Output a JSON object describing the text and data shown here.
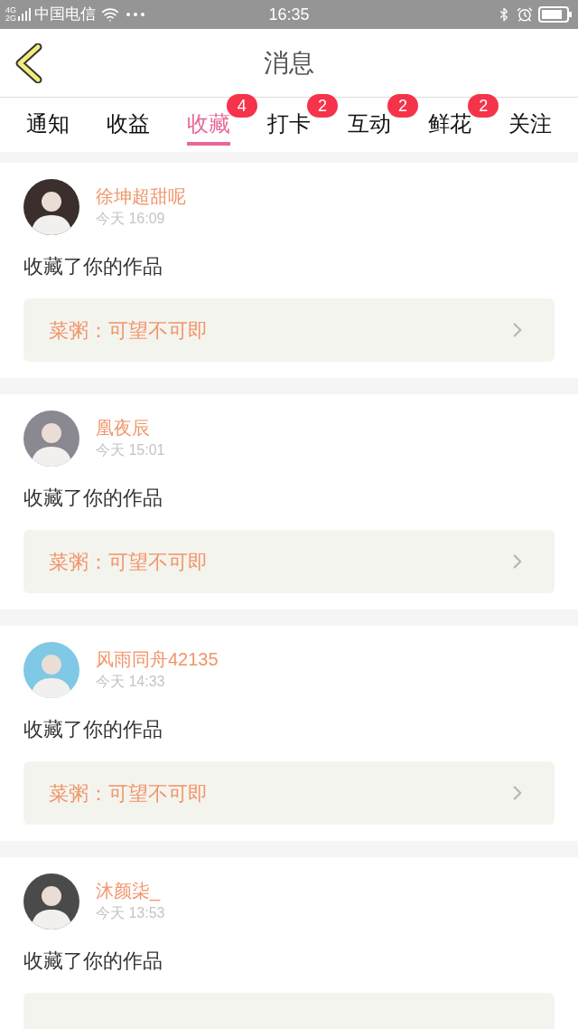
{
  "status_bar": {
    "network": [
      "4G",
      "2G"
    ],
    "carrier": "中国电信",
    "time": "16:35"
  },
  "header": {
    "title": "消息"
  },
  "tabs": [
    {
      "label": "通知",
      "selected": false
    },
    {
      "label": "收益",
      "selected": false
    },
    {
      "label": "收藏",
      "selected": true,
      "badge": "4"
    },
    {
      "label": "打卡",
      "selected": false,
      "badge": "2"
    },
    {
      "label": "互动",
      "selected": false,
      "badge": "2"
    },
    {
      "label": "鲜花",
      "selected": false,
      "badge": "2"
    },
    {
      "label": "关注",
      "selected": false
    }
  ],
  "messages": [
    {
      "user": "徐坤超甜呢",
      "time": "今天 16:09",
      "action": "收藏了你的作品",
      "link": "菜粥：可望不可即"
    },
    {
      "user": "凰夜辰",
      "time": "今天 15:01",
      "action": "收藏了你的作品",
      "link": "菜粥：可望不可即"
    },
    {
      "user": "风雨同舟42135",
      "time": "今天 14:33",
      "action": "收藏了你的作品",
      "link": "菜粥：可望不可即"
    },
    {
      "user": "沐颜柒_",
      "time": "今天 13:53",
      "action": "收藏了你的作品",
      "has_link": true
    }
  ]
}
